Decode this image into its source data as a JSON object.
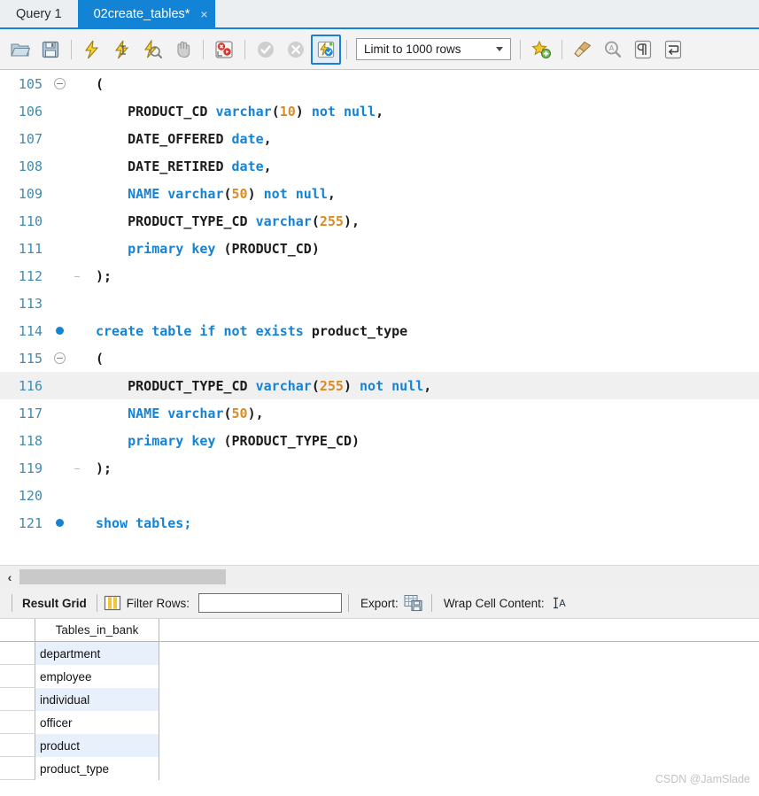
{
  "tabs": [
    {
      "label": "Query 1",
      "active": false,
      "closable": false
    },
    {
      "label": "02create_tables*",
      "active": true,
      "closable": true,
      "close_glyph": "×"
    }
  ],
  "toolbar": {
    "buttons": [
      {
        "name": "open-sql-script-icon",
        "title": "Open a SQL script file in a new query tab"
      },
      {
        "name": "save-script-icon",
        "title": "Save the script to a file"
      },
      {
        "name": "execute-statement-icon",
        "title": "Execute the selected portion of the script"
      },
      {
        "name": "execute-current-statement-icon",
        "title": "Execute the statement under the keyboard cursor"
      },
      {
        "name": "explain-statement-icon",
        "title": "Execute the EXPLAIN command on the statement"
      },
      {
        "name": "stop-execution-icon",
        "title": "Stop the query being executed"
      },
      {
        "name": "toggle-stop-on-error-icon",
        "title": "Toggle whether execution should stop on errors"
      },
      {
        "name": "commit-icon",
        "title": "Commit the current transaction"
      },
      {
        "name": "rollback-icon",
        "title": "Rollback the current transaction"
      },
      {
        "name": "toggle-autocommit-icon",
        "title": "Toggle autocommit mode",
        "selected": true
      },
      {
        "name": "add-snippet-icon",
        "title": "Save current statement or selection to the snippet list"
      },
      {
        "name": "beautify-sql-icon",
        "title": "Beautify/reformat the SQL script"
      },
      {
        "name": "find-icon",
        "title": "Show the Find panel for the editor"
      },
      {
        "name": "toggle-invisible-chars-icon",
        "title": "Toggle invisible characters"
      },
      {
        "name": "toggle-word-wrap-icon",
        "title": "Toggle wrapping of long lines"
      }
    ],
    "limit_selector": {
      "label_prefix": "Limit to",
      "value": "1000",
      "label_suffix": "rows",
      "full_text": "Limit to 1000 rows"
    }
  },
  "editor": {
    "lines": [
      {
        "num": "105",
        "marker": "fold",
        "gutter": "start",
        "tokens": [
          {
            "t": "(",
            "c": "pl"
          }
        ]
      },
      {
        "num": "106",
        "marker": "none",
        "gutter": "mid",
        "tokens": [
          {
            "t": "    PRODUCT_CD ",
            "c": "id"
          },
          {
            "t": "varchar",
            "c": "kw"
          },
          {
            "t": "(",
            "c": "pl"
          },
          {
            "t": "10",
            "c": "num"
          },
          {
            "t": ") ",
            "c": "pl"
          },
          {
            "t": "not null",
            "c": "kw"
          },
          {
            "t": ",",
            "c": "pl"
          }
        ]
      },
      {
        "num": "107",
        "marker": "none",
        "gutter": "mid",
        "tokens": [
          {
            "t": "    DATE_OFFERED ",
            "c": "id"
          },
          {
            "t": "date",
            "c": "kw"
          },
          {
            "t": ",",
            "c": "pl"
          }
        ]
      },
      {
        "num": "108",
        "marker": "none",
        "gutter": "mid",
        "tokens": [
          {
            "t": "    DATE_RETIRED ",
            "c": "id"
          },
          {
            "t": "date",
            "c": "kw"
          },
          {
            "t": ",",
            "c": "pl"
          }
        ]
      },
      {
        "num": "109",
        "marker": "none",
        "gutter": "mid",
        "tokens": [
          {
            "t": "    NAME",
            "c": "kw"
          },
          {
            "t": " ",
            "c": "pl"
          },
          {
            "t": "varchar",
            "c": "kw"
          },
          {
            "t": "(",
            "c": "pl"
          },
          {
            "t": "50",
            "c": "num"
          },
          {
            "t": ") ",
            "c": "pl"
          },
          {
            "t": "not null",
            "c": "kw"
          },
          {
            "t": ",",
            "c": "pl"
          }
        ]
      },
      {
        "num": "110",
        "marker": "none",
        "gutter": "mid",
        "tokens": [
          {
            "t": "    PRODUCT_TYPE_CD ",
            "c": "id"
          },
          {
            "t": "varchar",
            "c": "kw"
          },
          {
            "t": "(",
            "c": "pl"
          },
          {
            "t": "255",
            "c": "num"
          },
          {
            "t": "),",
            "c": "pl"
          }
        ]
      },
      {
        "num": "111",
        "marker": "none",
        "gutter": "mid",
        "tokens": [
          {
            "t": "    primary key",
            "c": "kw"
          },
          {
            "t": " (PRODUCT_CD)",
            "c": "id"
          }
        ]
      },
      {
        "num": "112",
        "marker": "none",
        "gutter": "end",
        "tokens": [
          {
            "t": ");",
            "c": "pl"
          }
        ]
      },
      {
        "num": "113",
        "marker": "none",
        "gutter": "none",
        "tokens": []
      },
      {
        "num": "114",
        "marker": "dot",
        "gutter": "none",
        "tokens": [
          {
            "t": "create table if not exists",
            "c": "kw"
          },
          {
            "t": " product_type",
            "c": "id"
          }
        ]
      },
      {
        "num": "115",
        "marker": "fold",
        "gutter": "start",
        "tokens": [
          {
            "t": "(",
            "c": "pl"
          }
        ]
      },
      {
        "num": "116",
        "marker": "none",
        "gutter": "mid",
        "current": true,
        "tokens": [
          {
            "t": "    PRODUCT_TYPE_CD ",
            "c": "id"
          },
          {
            "t": "varchar",
            "c": "kw"
          },
          {
            "t": "(",
            "c": "pl"
          },
          {
            "t": "255",
            "c": "num"
          },
          {
            "t": ") ",
            "c": "pl"
          },
          {
            "t": "not null",
            "c": "kw"
          },
          {
            "t": ",",
            "c": "pl"
          }
        ]
      },
      {
        "num": "117",
        "marker": "none",
        "gutter": "mid",
        "tokens": [
          {
            "t": "    NAME",
            "c": "kw"
          },
          {
            "t": " ",
            "c": "pl"
          },
          {
            "t": "varchar",
            "c": "kw"
          },
          {
            "t": "(",
            "c": "pl"
          },
          {
            "t": "50",
            "c": "num"
          },
          {
            "t": "),",
            "c": "pl"
          }
        ]
      },
      {
        "num": "118",
        "marker": "none",
        "gutter": "mid",
        "tokens": [
          {
            "t": "    primary key",
            "c": "kw"
          },
          {
            "t": " (PRODUCT_TYPE_CD)",
            "c": "id"
          }
        ]
      },
      {
        "num": "119",
        "marker": "none",
        "gutter": "end",
        "tokens": [
          {
            "t": ");",
            "c": "pl"
          }
        ]
      },
      {
        "num": "120",
        "marker": "none",
        "gutter": "none",
        "tokens": []
      },
      {
        "num": "121",
        "marker": "dot",
        "gutter": "none",
        "tokens": [
          {
            "t": "show tables;",
            "c": "kw"
          }
        ]
      }
    ]
  },
  "scrollbar": {
    "left_arrow": "‹"
  },
  "result_toolbar": {
    "result_grid_label": "Result Grid",
    "grid_view_icon": "grid-view-icon",
    "filter_rows_label": "Filter Rows:",
    "filter_rows_value": "",
    "filter_rows_placeholder": "",
    "export_label": "Export:",
    "export_icon": "export-recordset-icon",
    "wrap_label": "Wrap Cell Content:",
    "wrap_icon": "wrap-cell-content-icon"
  },
  "result_grid": {
    "columns": [
      "Tables_in_bank"
    ],
    "rows": [
      [
        "department"
      ],
      [
        "employee"
      ],
      [
        "individual"
      ],
      [
        "officer"
      ],
      [
        "product"
      ],
      [
        "product_type"
      ]
    ]
  },
  "watermark": "CSDN @JamSlade",
  "colors": {
    "accent_blue": "#1383d6",
    "keyword_blue": "#1383d6",
    "number_orange": "#d98c24",
    "linenum_teal": "#3f8ab0",
    "row_alt": "#e8f0fb",
    "toolbar_bg": "#f3f3f3"
  }
}
